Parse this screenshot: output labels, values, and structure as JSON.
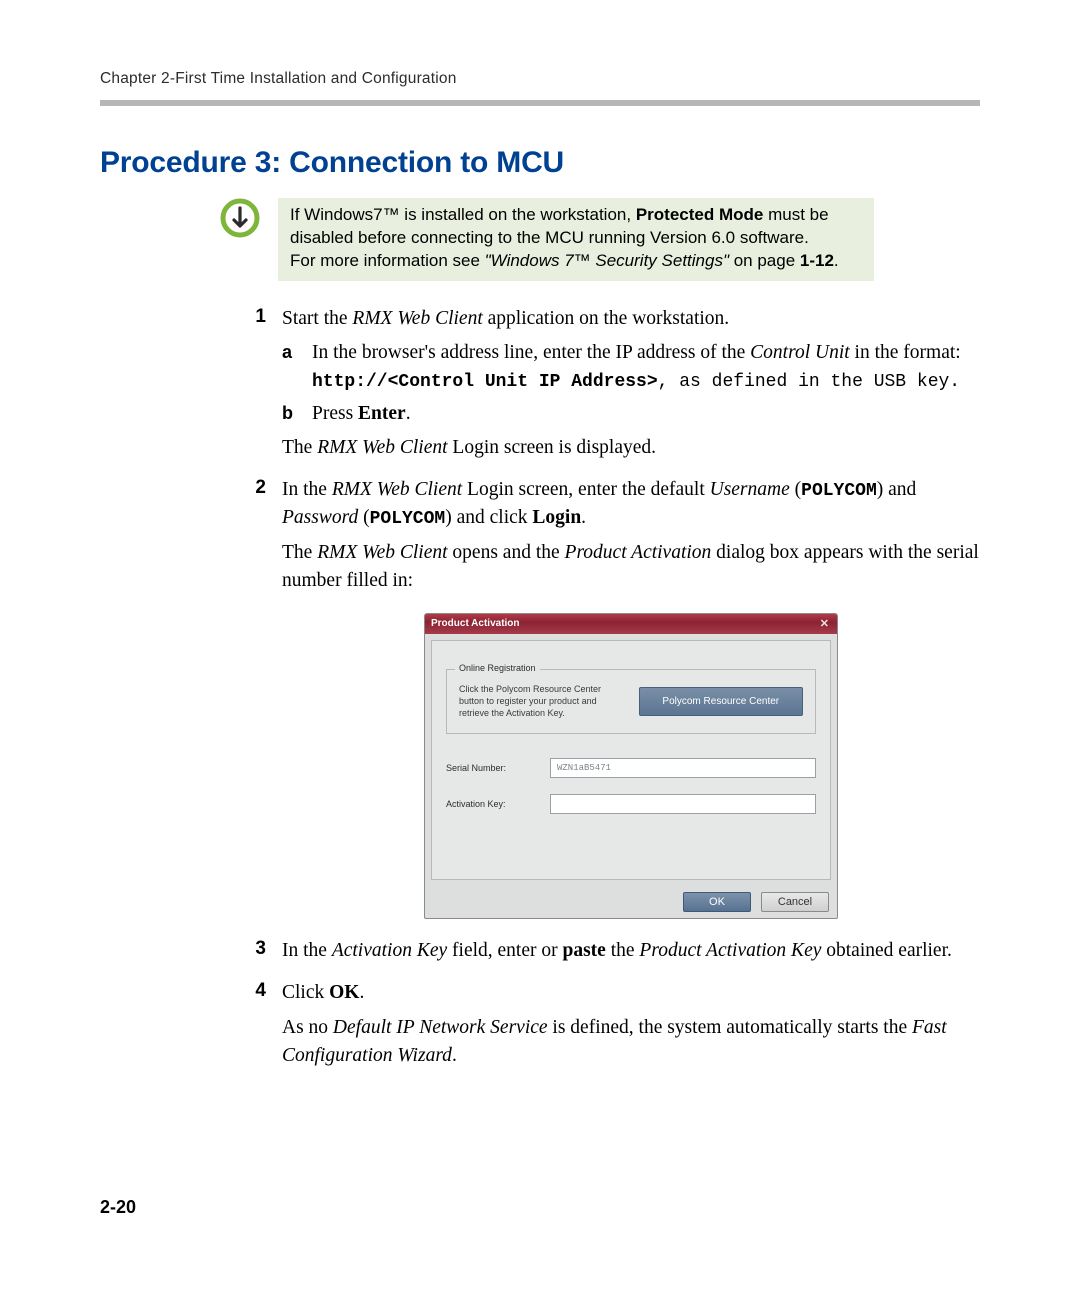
{
  "header": {
    "running": "Chapter 2-First Time Installation and Configuration"
  },
  "heading": "Procedure 3: Connection to MCU",
  "note": {
    "line1a": "If Windows7™ is installed on the workstation, ",
    "line1b": "Protected Mode",
    "line1c": " must be disabled before connecting to the MCU running Version 6.0 software.",
    "line2a": "For more information see ",
    "line2b": "\"Windows 7™ Security Settings\"",
    "line2c": " on page ",
    "line2d": "1-12",
    "line2e": "."
  },
  "steps": {
    "s1": {
      "num": "1",
      "body1a": "Start the ",
      "body1b": "RMX Web Client",
      "body1c": " application on the workstation.",
      "a_letter": "a",
      "a1": "In the browser's address line, enter the IP address of the ",
      "a2": "Control Unit",
      "a3": " in the format: ",
      "a4": "http://<Control Unit IP Address>",
      "a5": ", as defined in the USB key.",
      "b_letter": "b",
      "b1": "Press ",
      "b2": "Enter",
      "b3": ".",
      "after1a": "The ",
      "after1b": "RMX Web Client",
      "after1c": " Login screen is displayed."
    },
    "s2": {
      "num": "2",
      "p1a": "In the ",
      "p1b": "RMX Web Client",
      "p1c": " Login screen, enter the default ",
      "p1d": "Username",
      "p1e": " (",
      "p1f": "POLYCOM",
      "p1g": ") and ",
      "p1h": "Password",
      "p1i": " (",
      "p1j": "POLYCOM",
      "p1k": ") and click ",
      "p1l": "Login",
      "p1m": ".",
      "p2a": "The ",
      "p2b": "RMX Web Client",
      "p2c": " opens and the ",
      "p2d": "Product Activation",
      "p2e": " dialog box appears with the serial number filled in:"
    },
    "s3": {
      "num": "3",
      "p1a": "In the ",
      "p1b": "Activation Key",
      "p1c": " field, enter or ",
      "p1d": "paste",
      "p1e": " the ",
      "p1f": "Product Activation Key",
      "p1g": " obtained earlier."
    },
    "s4": {
      "num": "4",
      "p1a": "Click ",
      "p1b": "OK",
      "p1c": ".",
      "p2a": "As no ",
      "p2b": "Default IP Network Service",
      "p2c": " is defined, the system automatically starts the ",
      "p2d": "Fast Configuration Wizard",
      "p2e": "."
    }
  },
  "dialog": {
    "title": "Product Activation",
    "close": "✕",
    "legend": "Online Registration",
    "helptext": "Click the Polycom Resource Center button to register your product and retrieve the Activation Key.",
    "prc_button": "Polycom Resource Center",
    "serial_label": "Serial Number:",
    "serial_value": "WZN1aB5471",
    "activation_label": "Activation Key:",
    "activation_value": "",
    "ok": "OK",
    "cancel": "Cancel"
  },
  "page_number": "2-20"
}
